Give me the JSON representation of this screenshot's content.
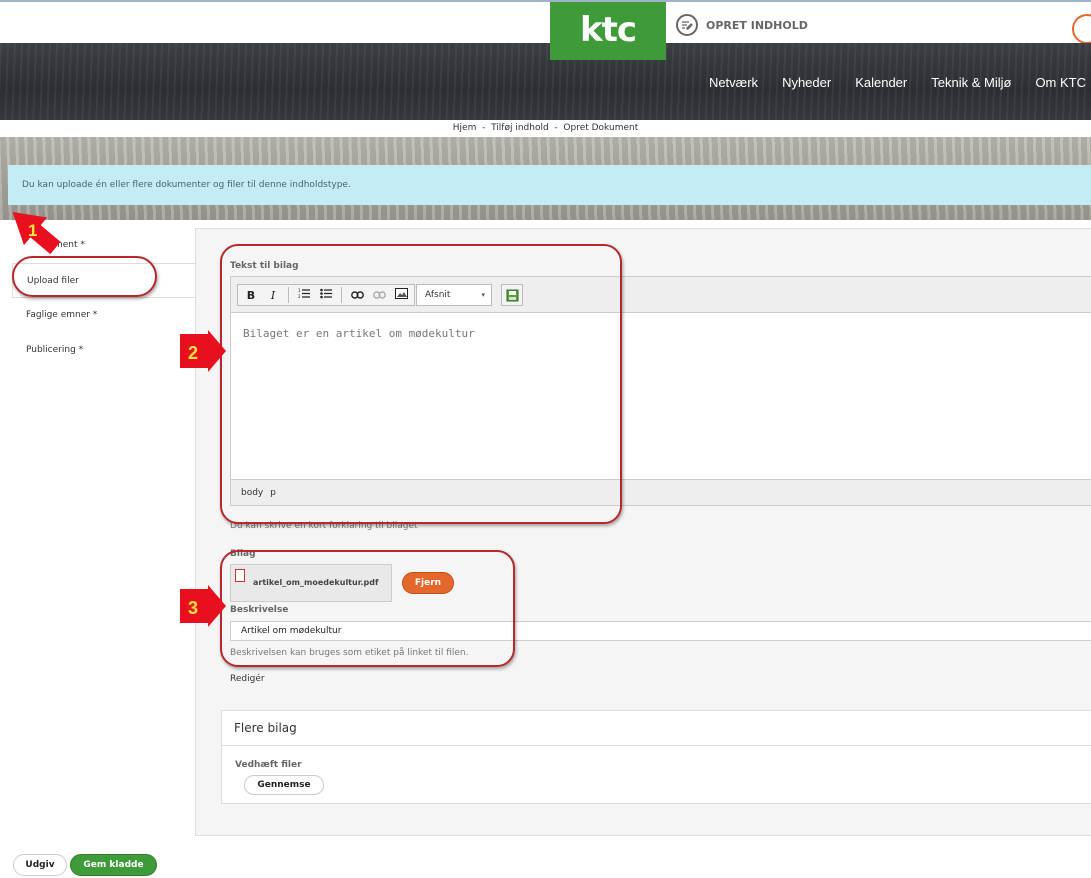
{
  "header": {
    "logo_text": "ktc",
    "create_content_label": "OPRET INDHOLD",
    "nav_items": [
      "Netværk",
      "Nyheder",
      "Kalender",
      "Teknik & Miljø",
      "Om KTC"
    ]
  },
  "breadcrumb": {
    "items": [
      "Hjem",
      "Tilføj indhold",
      "Opret Dokument"
    ],
    "separator": "-"
  },
  "info_message": "Du kan uploade én eller flere dokumenter og filer til denne indholdstype.",
  "tabs": [
    {
      "label": "Dokument *",
      "partially_hidden_as": "ment *"
    },
    {
      "label": "Upload filer",
      "active": true
    },
    {
      "label": "Faglige emner *"
    },
    {
      "label": "Publicering *"
    }
  ],
  "attachment_text": {
    "label": "Tekst til bilag",
    "editor_content": "Bilaget er en artikel om mødekultur",
    "toolbar": {
      "format_select": "Afsnit"
    },
    "statusbar": "body  p",
    "hint": "Du kan skrive en kort forklaring til bilaget"
  },
  "attachment": {
    "label": "Bilag",
    "file_name": "artikel_om_moedekultur.pdf",
    "remove_label": "Fjern",
    "description_label": "Beskrivelse",
    "description_value": "Artikel om mødekultur",
    "description_hint": "Beskrivelsen kan bruges som etiket på linket til filen.",
    "edit_label": "Redigér"
  },
  "more_attachments": {
    "title": "Flere bilag",
    "attach_label": "Vedhæft filer",
    "browse_label": "Gennemse"
  },
  "footer": {
    "publish_label": "Udgiv",
    "save_draft_label": "Gem kladde"
  },
  "annotations": {
    "markers": [
      "1",
      "2",
      "3"
    ],
    "ring_color": "#b5282b",
    "marker_color": "#e8101e",
    "marker_text_color": "#ffe43a"
  },
  "colors": {
    "brand_green": "#3f9a3a",
    "accent_orange": "#e4672c",
    "info_bg": "#c5ebf5"
  }
}
